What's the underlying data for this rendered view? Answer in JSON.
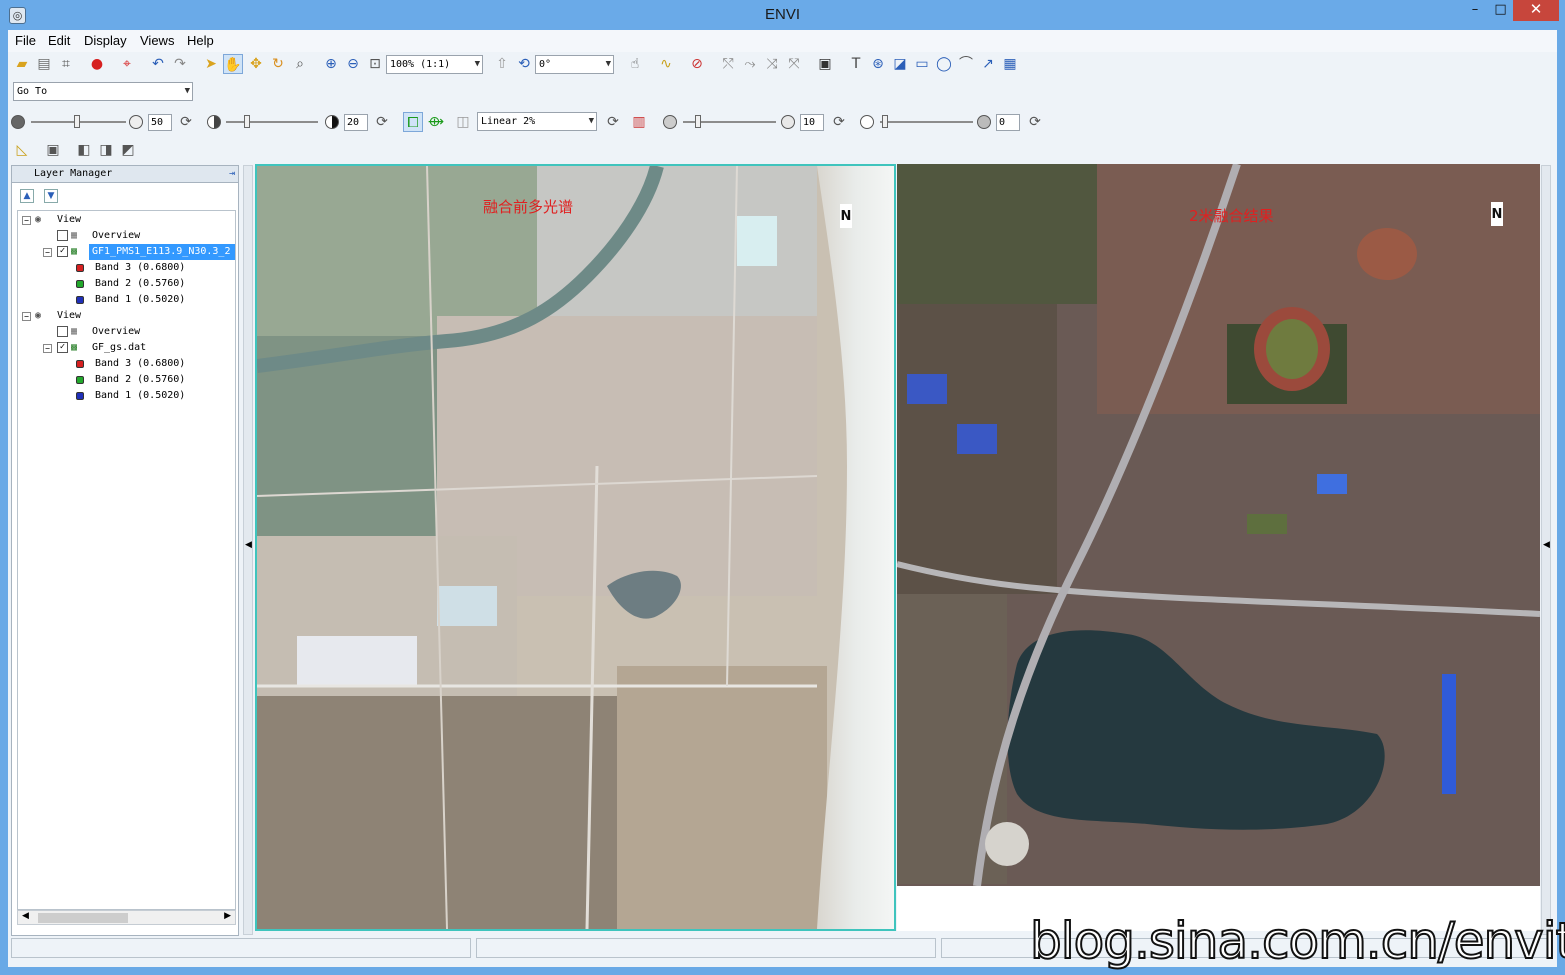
{
  "window": {
    "title": "ENVI",
    "minimize": "–",
    "maximize": "□",
    "close": "✕"
  },
  "menu": [
    {
      "label": "File"
    },
    {
      "label": "Edit"
    },
    {
      "label": "Display"
    },
    {
      "label": "Views"
    },
    {
      "label": "Help"
    }
  ],
  "toolbar": {
    "zoom_value": "100% (1:1)",
    "rotation_value": "0°",
    "goto_value": "Go To",
    "brightness_value": "50",
    "contrast_value": "20",
    "stretch_value": "Linear 2%",
    "sharpen_value": "10",
    "transparency_value": "0"
  },
  "layer_manager": {
    "title": "Layer Manager",
    "tree": [
      {
        "label": "View",
        "type": "view"
      },
      {
        "label": "Overview",
        "type": "overview",
        "checked": false
      },
      {
        "label": "GF1_PMS1_E113.9_N30.3_2",
        "type": "layer",
        "checked": true,
        "selected": true
      },
      {
        "label": "Band 3 (0.6800)",
        "type": "band",
        "color": "#d62020"
      },
      {
        "label": "Band 2 (0.5760)",
        "type": "band",
        "color": "#22a82c"
      },
      {
        "label": "Band 1 (0.5020)",
        "type": "band",
        "color": "#1f2fb8"
      },
      {
        "label": "View",
        "type": "view"
      },
      {
        "label": "Overview",
        "type": "overview",
        "checked": false
      },
      {
        "label": "GF_gs.dat",
        "type": "layer",
        "checked": true,
        "selected": false
      },
      {
        "label": "Band 3 (0.6800)",
        "type": "band",
        "color": "#d62020"
      },
      {
        "label": "Band 2 (0.5760)",
        "type": "band",
        "color": "#22a82c"
      },
      {
        "label": "Band 1 (0.5020)",
        "type": "band",
        "color": "#1f2fb8"
      }
    ]
  },
  "views": {
    "left": {
      "annotation": "融合前多光谱",
      "north": "N"
    },
    "right": {
      "annotation": "2米融合结果",
      "north": "N"
    }
  },
  "watermark": "blog.sina.com.cn/envitdl",
  "colors": {
    "title_bar": "#6aaae8",
    "close_button": "#c7463c",
    "active_view_border": "#3fc4bd",
    "annotation_red": "#e02020",
    "selection_blue": "#3399ff"
  }
}
